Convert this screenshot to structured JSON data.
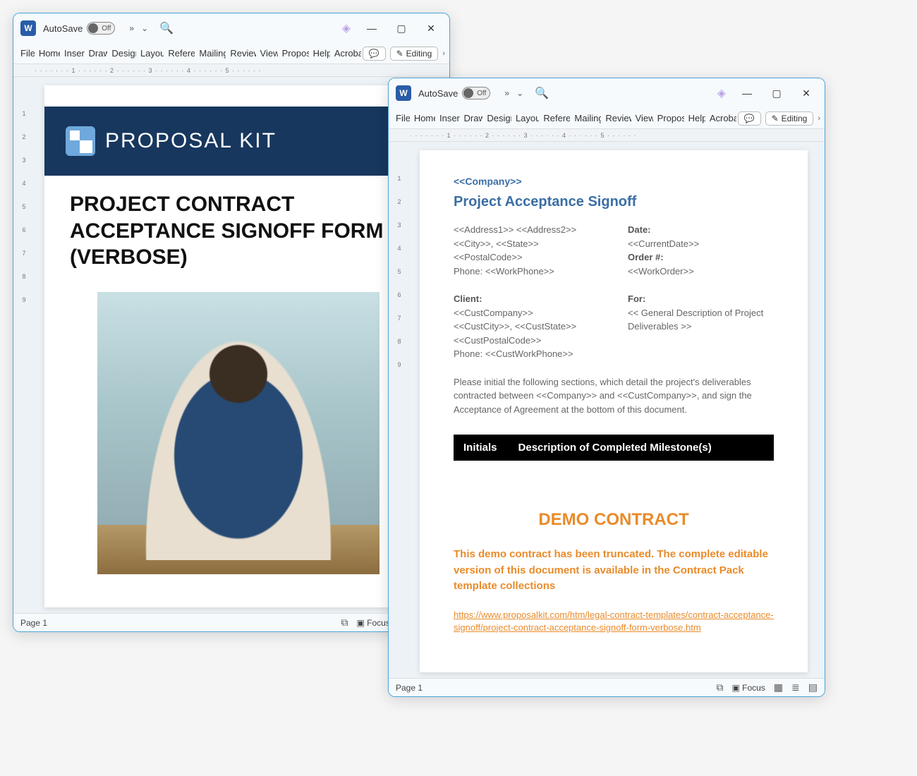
{
  "titlebar": {
    "autosave_label": "AutoSave",
    "toggle_state": "Off",
    "more": "»",
    "caret": "⌄",
    "minimize": "—",
    "maximize": "▢",
    "close": "✕"
  },
  "ribbon": {
    "tabs": [
      "File",
      "Home",
      "Insert",
      "Draw",
      "Design",
      "Layout",
      "References",
      "Mailings",
      "Review",
      "View",
      "Proposal",
      "Help",
      "Acrobat"
    ],
    "comments_icon": "💬",
    "editing_label": "Editing",
    "editing_icon": "✎"
  },
  "ruler_text": "· · · · · · · 1 · · · · · · 2 · · · · · · 3 · · · · · · 4 · · · · · · 5 · · · · · · ",
  "vruler_marks": [
    "1",
    "2",
    "3",
    "4",
    "5",
    "6",
    "7",
    "8",
    "9"
  ],
  "statusbar": {
    "page_label": "Page 1",
    "focus_label": "Focus"
  },
  "doc1": {
    "brand": "PROPOSAL KIT",
    "title": "PROJECT CONTRACT ACCEPTANCE SIGNOFF FORM (VERBOSE)"
  },
  "doc2": {
    "company": "<<Company>>",
    "heading": "Project Acceptance Signoff",
    "addr_block": "<<Address1>> <<Address2>>\n<<City>>, <<State>> <<PostalCode>>\nPhone: <<WorkPhone>>",
    "date_label": "Date:",
    "date_val": "<<CurrentDate>>",
    "order_label": "Order #:",
    "order_val": "<<WorkOrder>>",
    "client_label": "Client:",
    "client_block": "<<CustCompany>>\n<<CustCity>>, <<CustState>>\n<<CustPostalCode>>\nPhone: <<CustWorkPhone>>",
    "for_label": "For:",
    "for_block": "<< General Description of Project Deliverables >>",
    "intro": "Please initial the following sections, which detail the project's deliverables contracted between <<Company>> and <<CustCompany>>, and sign the Acceptance of Agreement at the bottom of this document.",
    "col_initials": "Initials",
    "col_desc": "Description of Completed Milestone(s)",
    "demo_title": "DEMO CONTRACT",
    "demo_text": "This demo contract has been truncated. The complete editable version of this document is available in the Contract Pack template collections",
    "demo_link": "https://www.proposalkit.com/htm/legal-contract-templates/contract-acceptance-signoff/project-contract-acceptance-signoff-form-verbose.htm"
  }
}
